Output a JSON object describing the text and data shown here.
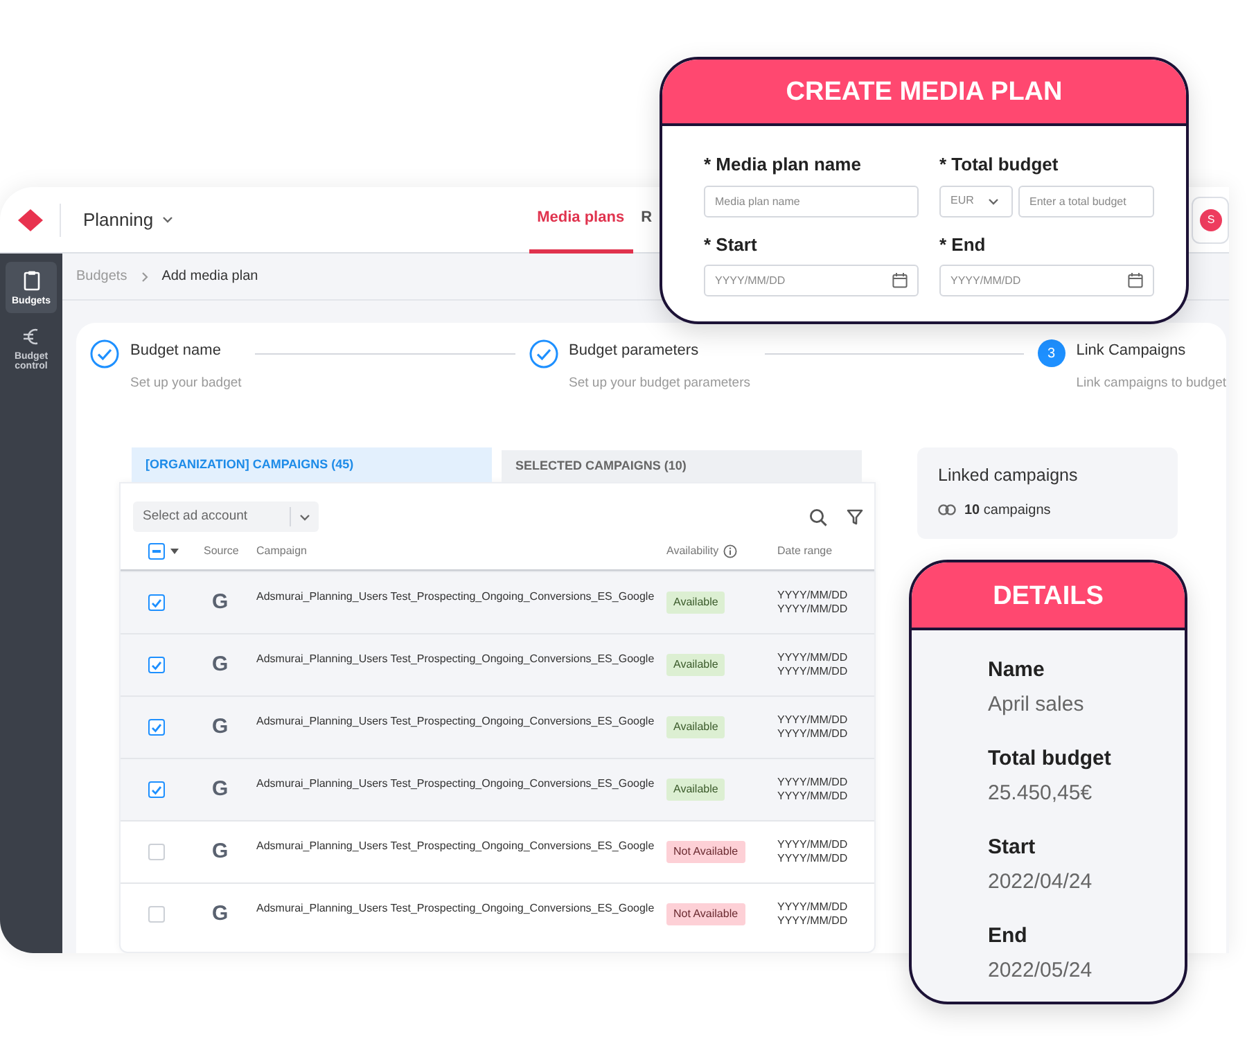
{
  "header": {
    "app_menu": "Planning",
    "tabs": [
      {
        "label": "Media plans",
        "selected": true
      },
      {
        "label": "R",
        "selected": false
      }
    ],
    "avatar": "S"
  },
  "sidebar": {
    "items": [
      {
        "label": "Budgets",
        "selected": true
      },
      {
        "label": "Budget control",
        "selected": false
      }
    ]
  },
  "breadcrumb": [
    "Budgets",
    "Add media plan"
  ],
  "steps": [
    {
      "title": "Budget name",
      "subtitle": "Set up your badget",
      "done": true
    },
    {
      "title": "Budget parameters",
      "subtitle": "Set up your budget parameters",
      "done": true
    },
    {
      "number": "3",
      "title": "Link Campaigns",
      "subtitle": "Link campaigns to budget",
      "done": false
    }
  ],
  "campaign_tabs": [
    {
      "label": "[ORGANIZATION] CAMPAIGNS (45)",
      "selected": true
    },
    {
      "label": "SELECTED CAMPAIGNS (10)",
      "selected": false
    }
  ],
  "account_select": {
    "placeholder": "Select ad account"
  },
  "table": {
    "indeterminate": true,
    "columns": [
      "Source",
      "Campaign",
      "Availability",
      "Date range"
    ],
    "rows": [
      {
        "checked": true,
        "source": "G",
        "campaign": "Adsmurai_Planning_Users Test_Prospecting_Ongoing_Conversions_ES_Google",
        "availability": "Available",
        "available": true,
        "start": "YYYY/MM/DD",
        "end": "YYYY/MM/DD"
      },
      {
        "checked": true,
        "source": "G",
        "campaign": "Adsmurai_Planning_Users Test_Prospecting_Ongoing_Conversions_ES_Google",
        "availability": "Available",
        "available": true,
        "start": "YYYY/MM/DD",
        "end": "YYYY/MM/DD"
      },
      {
        "checked": true,
        "source": "G",
        "campaign": "Adsmurai_Planning_Users Test_Prospecting_Ongoing_Conversions_ES_Google",
        "availability": "Available",
        "available": true,
        "start": "YYYY/MM/DD",
        "end": "YYYY/MM/DD"
      },
      {
        "checked": true,
        "source": "G",
        "campaign": "Adsmurai_Planning_Users Test_Prospecting_Ongoing_Conversions_ES_Google",
        "availability": "Available",
        "available": true,
        "start": "YYYY/MM/DD",
        "end": "YYYY/MM/DD"
      },
      {
        "checked": false,
        "source": "G",
        "campaign": "Adsmurai_Planning_Users Test_Prospecting_Ongoing_Conversions_ES_Google",
        "availability": "Not Available",
        "available": false,
        "start": "YYYY/MM/DD",
        "end": "YYYY/MM/DD"
      },
      {
        "checked": false,
        "source": "G",
        "campaign": "Adsmurai_Planning_Users Test_Prospecting_Ongoing_Conversions_ES_Google",
        "availability": "Not Available",
        "available": false,
        "start": "YYYY/MM/DD",
        "end": "YYYY/MM/DD"
      }
    ]
  },
  "linked": {
    "title": "Linked campaigns",
    "summary": "**10** campaigns"
  },
  "create_plan": {
    "title": "CREATE MEDIA PLAN",
    "fields": [
      {
        "kind": "text",
        "label": "* Media plan name",
        "placeholder": "Media plan name"
      },
      {
        "kind": "currency",
        "label": "* Total budget",
        "currency": "EUR",
        "placeholder": "Enter a total budget"
      },
      {
        "kind": "date",
        "label": "* Start",
        "placeholder": "YYYY/MM/DD"
      },
      {
        "kind": "date",
        "label": "* End",
        "placeholder": "YYYY/MM/DD"
      }
    ]
  },
  "details": {
    "title": "DETAILS",
    "items": [
      {
        "label": "Name",
        "value": "April sales"
      },
      {
        "label": "Total budget",
        "value": "25.450,45€"
      },
      {
        "label": "Start",
        "value": "2022/04/24"
      },
      {
        "label": "End",
        "value": "2022/05/24"
      }
    ]
  }
}
